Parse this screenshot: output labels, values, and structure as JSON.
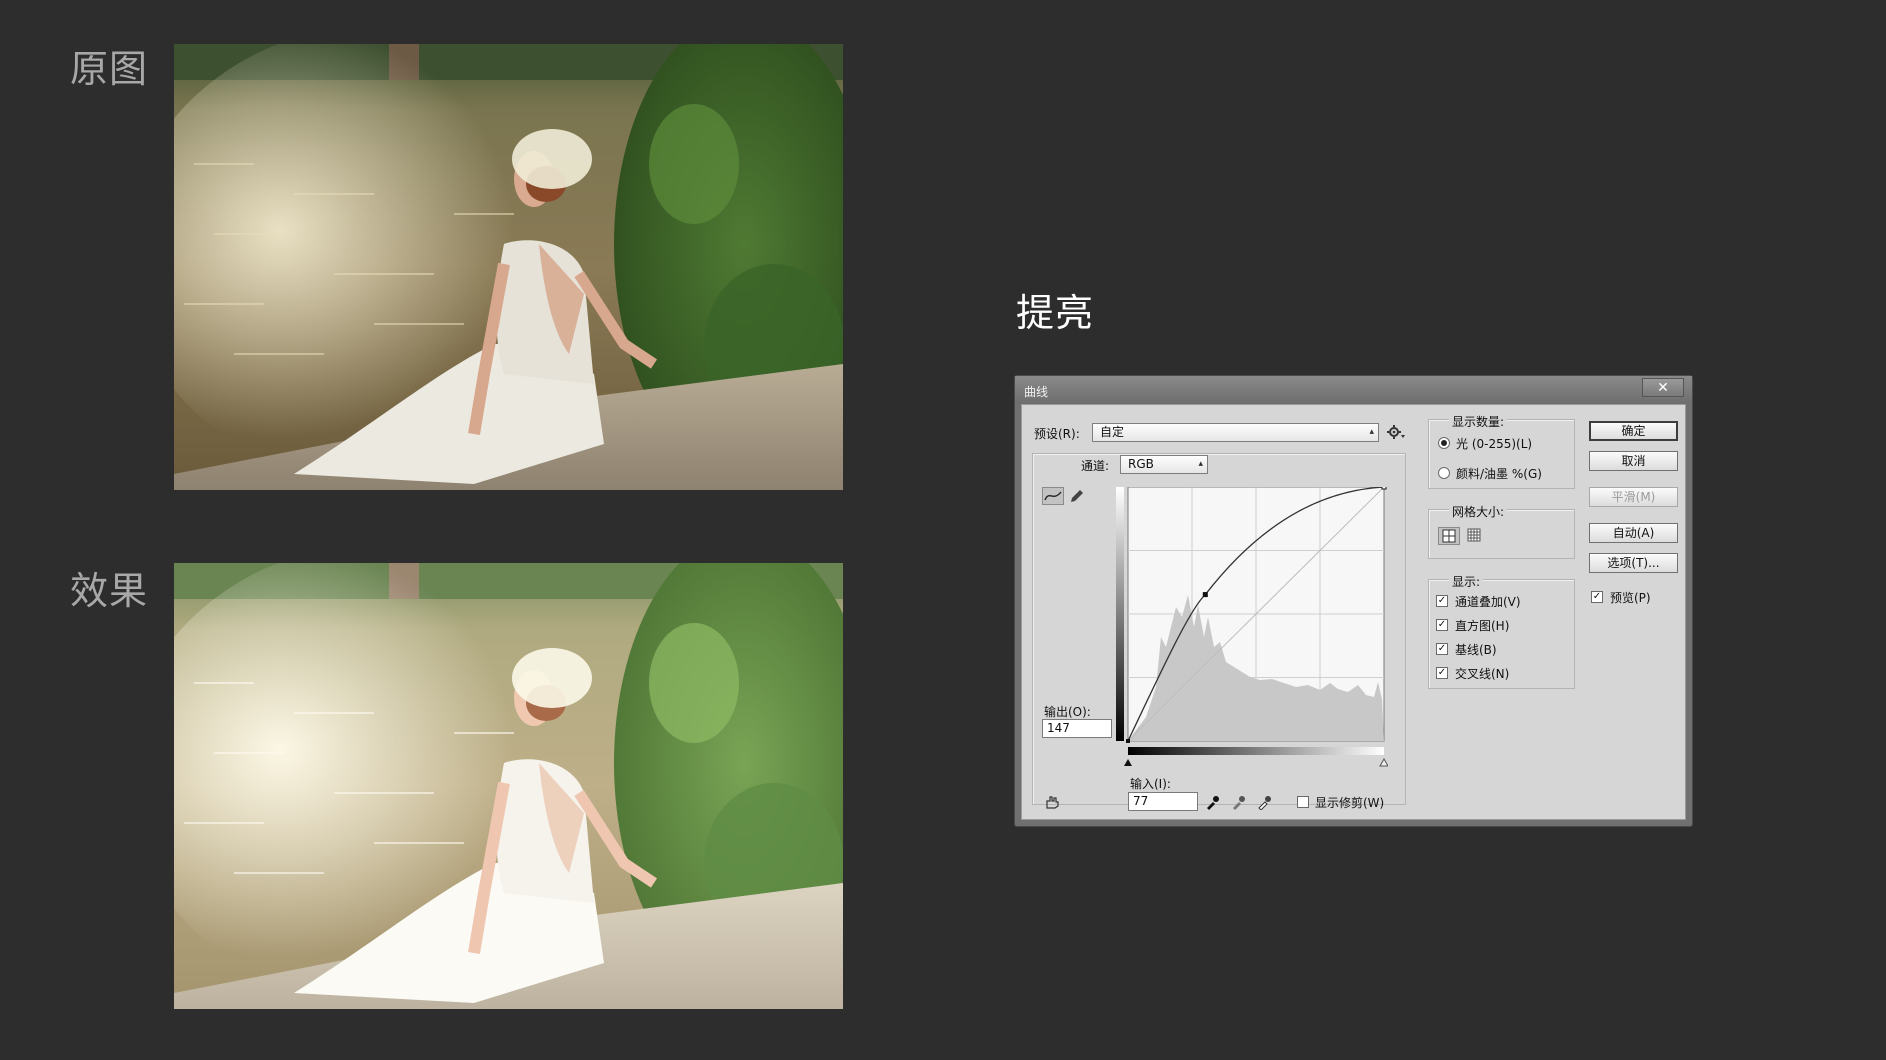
{
  "labels": {
    "original": "原图",
    "effect": "效果",
    "brighten": "提亮"
  },
  "dialog": {
    "title": "曲线",
    "close_icon": "close-x-icon",
    "preset_label": "预设(R):",
    "preset_value": "自定",
    "channel_label": "通道:",
    "channel_value": "RGB",
    "output_label": "输出(O):",
    "output_value": "147",
    "input_label": "输入(I):",
    "input_value": "77",
    "show_clipping_label": "显示修剪(W)",
    "show_clipping_checked": false,
    "curve_point": {
      "input": 77,
      "output": 147
    },
    "display_amount": {
      "title": "显示数量:",
      "light": "光 (0-255)(L)",
      "pigment": "颜料/油墨 %(G)",
      "selected": "light"
    },
    "grid_size": {
      "title": "网格大小:"
    },
    "show": {
      "title": "显示:",
      "items": [
        {
          "label": "通道叠加(V)",
          "checked": true
        },
        {
          "label": "直方图(H)",
          "checked": true
        },
        {
          "label": "基线(B)",
          "checked": true
        },
        {
          "label": "交叉线(N)",
          "checked": true
        }
      ]
    },
    "buttons": {
      "ok": "确定",
      "cancel": "取消",
      "smooth": "平滑(M)",
      "auto": "自动(A)",
      "options": "选项(T)..."
    },
    "preview_label": "预览(P)",
    "preview_checked": true
  }
}
